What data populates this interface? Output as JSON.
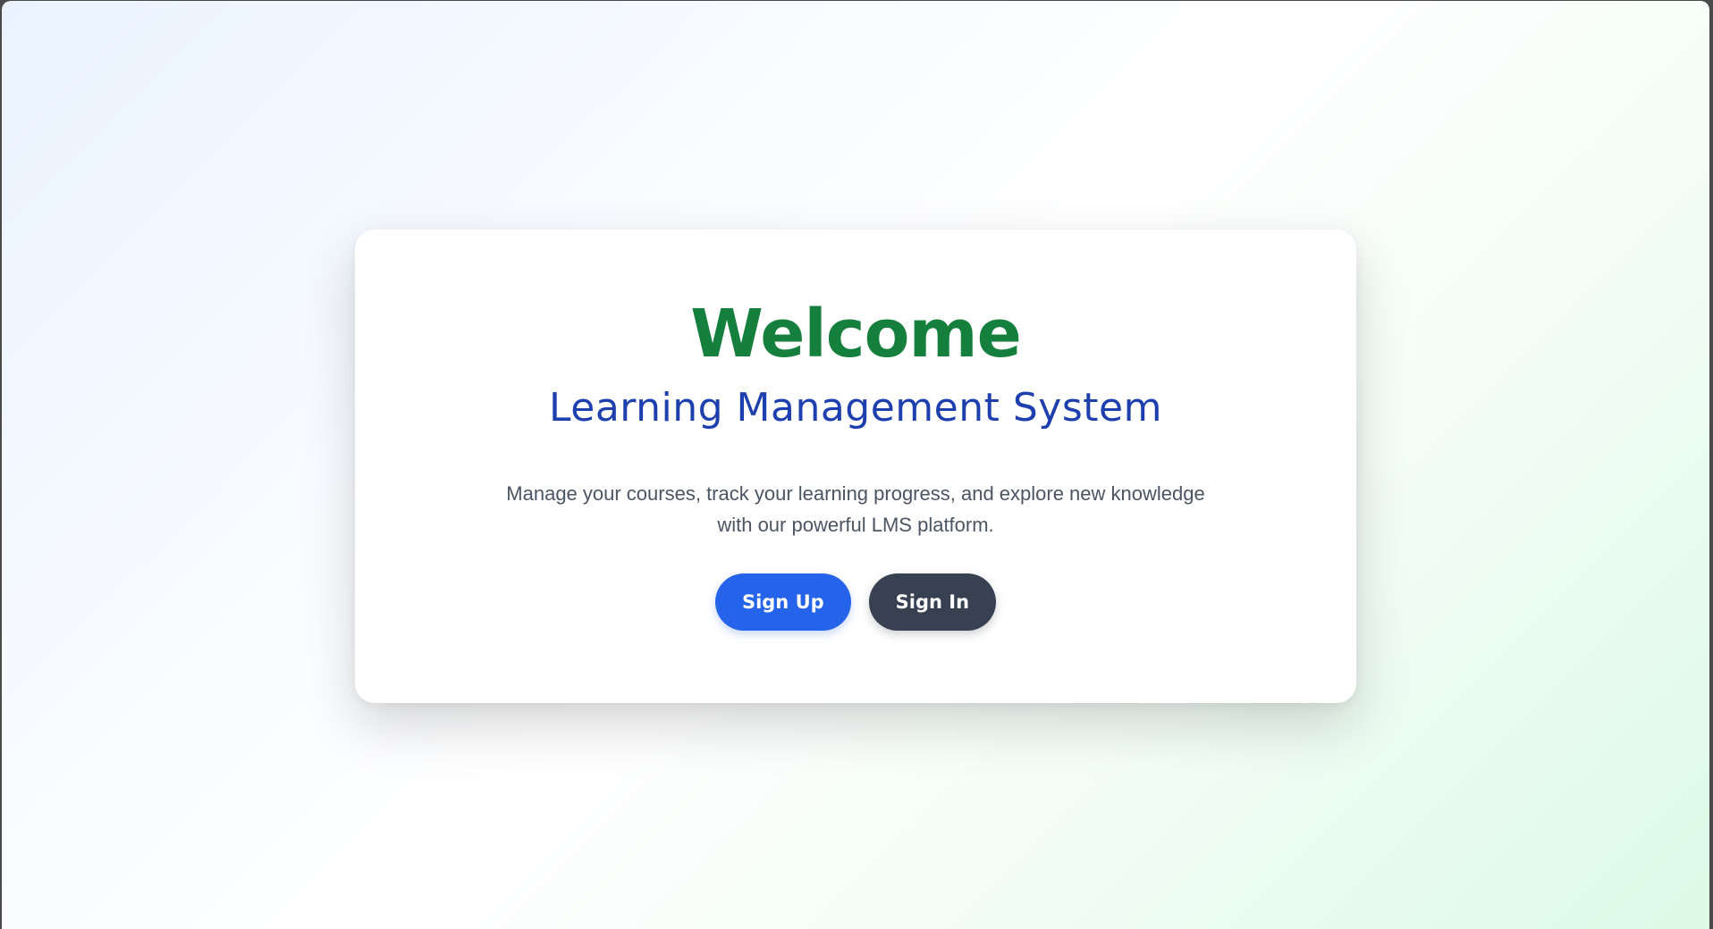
{
  "welcome": {
    "title": "Welcome",
    "subtitle": "Learning Management System",
    "description": "Manage your courses, track your learning progress, and explore new knowledge with our powerful LMS platform.",
    "signup_label": "Sign Up",
    "signin_label": "Sign In"
  },
  "colors": {
    "title": "#15803d",
    "subtitle": "#1e40af",
    "description": "#4b5563",
    "signup_button": "#2563eb",
    "signin_button": "#374151",
    "card": "#ffffff"
  }
}
